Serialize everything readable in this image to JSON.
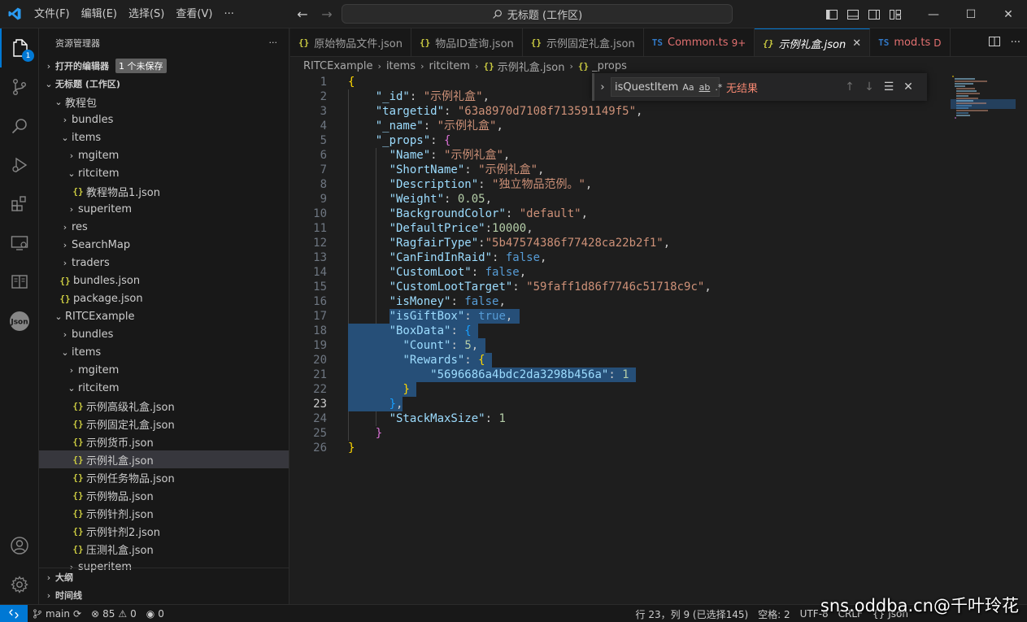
{
  "titlebar": {
    "menu": [
      "文件(F)",
      "编辑(E)",
      "选择(S)",
      "查看(V)",
      "···"
    ],
    "search_text": "无标题 (工作区)"
  },
  "activity": {
    "explorer_badge": "1",
    "json_label": "Json"
  },
  "sidebar": {
    "header": "资源管理器",
    "more": "···",
    "open_editors": "打开的编辑器",
    "unsaved_badge": "1 个未保存",
    "workspace": "无标题 (工作区)",
    "tree": [
      {
        "label": "教程包",
        "indent": 1,
        "type": "folder-open"
      },
      {
        "label": "bundles",
        "indent": 2,
        "type": "folder"
      },
      {
        "label": "items",
        "indent": 2,
        "type": "folder-open"
      },
      {
        "label": "mgitem",
        "indent": 3,
        "type": "folder"
      },
      {
        "label": "ritcitem",
        "indent": 3,
        "type": "folder-open"
      },
      {
        "label": "教程物品1.json",
        "indent": 4,
        "type": "json"
      },
      {
        "label": "superitem",
        "indent": 3,
        "type": "folder"
      },
      {
        "label": "res",
        "indent": 2,
        "type": "folder"
      },
      {
        "label": "SearchMap",
        "indent": 2,
        "type": "folder"
      },
      {
        "label": "traders",
        "indent": 2,
        "type": "folder"
      },
      {
        "label": "bundles.json",
        "indent": 2,
        "type": "json"
      },
      {
        "label": "package.json",
        "indent": 2,
        "type": "json"
      },
      {
        "label": "RITCExample",
        "indent": 1,
        "type": "folder-open"
      },
      {
        "label": "bundles",
        "indent": 2,
        "type": "folder"
      },
      {
        "label": "items",
        "indent": 2,
        "type": "folder-open"
      },
      {
        "label": "mgitem",
        "indent": 3,
        "type": "folder"
      },
      {
        "label": "ritcitem",
        "indent": 3,
        "type": "folder-open"
      },
      {
        "label": "示例高级礼盒.json",
        "indent": 4,
        "type": "json"
      },
      {
        "label": "示例固定礼盒.json",
        "indent": 4,
        "type": "json"
      },
      {
        "label": "示例货币.json",
        "indent": 4,
        "type": "json"
      },
      {
        "label": "示例礼盒.json",
        "indent": 4,
        "type": "json",
        "selected": true
      },
      {
        "label": "示例任务物品.json",
        "indent": 4,
        "type": "json"
      },
      {
        "label": "示例物品.json",
        "indent": 4,
        "type": "json"
      },
      {
        "label": "示例针剂.json",
        "indent": 4,
        "type": "json"
      },
      {
        "label": "示例针剂2.json",
        "indent": 4,
        "type": "json"
      },
      {
        "label": "压测礼盒.json",
        "indent": 4,
        "type": "json"
      },
      {
        "label": "superitem",
        "indent": 3,
        "type": "folder"
      }
    ],
    "outline": "大纲",
    "timeline": "时间线"
  },
  "tabs": [
    {
      "label": "原始物品文件.json",
      "kind": "json"
    },
    {
      "label": "物品ID查询.json",
      "kind": "json"
    },
    {
      "label": "示例固定礼盒.json",
      "kind": "json"
    },
    {
      "label": "Common.ts",
      "kind": "ts",
      "badge": "9+",
      "warn": true
    },
    {
      "label": "示例礼盒.json",
      "kind": "json",
      "active": true
    },
    {
      "label": "mod.ts",
      "kind": "ts",
      "badge": "D",
      "warn": true
    }
  ],
  "breadcrumb": [
    "RITCExample",
    "items",
    "ritcitem",
    "示例礼盒.json",
    "_props"
  ],
  "find": {
    "value": "isQuestItem",
    "opt_case": "Aa",
    "opt_word": "ab",
    "opt_regex": ".*",
    "result": "无结果"
  },
  "code_lines": [
    [
      [
        "{",
        "br1"
      ]
    ],
    [
      [
        "    ",
        ""
      ],
      [
        "\"_id\"",
        "k"
      ],
      [
        ": ",
        "p"
      ],
      [
        "\"示例礼盒\"",
        "s"
      ],
      [
        ",",
        "p"
      ]
    ],
    [
      [
        "    ",
        ""
      ],
      [
        "\"targetid\"",
        "k"
      ],
      [
        ": ",
        "p"
      ],
      [
        "\"63a8970d7108f713591149f5\"",
        "s"
      ],
      [
        ",",
        "p"
      ]
    ],
    [
      [
        "    ",
        ""
      ],
      [
        "\"_name\"",
        "k"
      ],
      [
        ": ",
        "p"
      ],
      [
        "\"示例礼盒\"",
        "s"
      ],
      [
        ",",
        "p"
      ]
    ],
    [
      [
        "    ",
        ""
      ],
      [
        "\"_props\"",
        "k"
      ],
      [
        ": ",
        "p"
      ],
      [
        "{",
        "br2"
      ]
    ],
    [
      [
        "      ",
        ""
      ],
      [
        "\"Name\"",
        "k"
      ],
      [
        ": ",
        "p"
      ],
      [
        "\"示例礼盒\"",
        "s"
      ],
      [
        ",",
        "p"
      ]
    ],
    [
      [
        "      ",
        ""
      ],
      [
        "\"ShortName\"",
        "k"
      ],
      [
        ": ",
        "p"
      ],
      [
        "\"示例礼盒\"",
        "s"
      ],
      [
        ",",
        "p"
      ]
    ],
    [
      [
        "      ",
        ""
      ],
      [
        "\"Description\"",
        "k"
      ],
      [
        ": ",
        "p"
      ],
      [
        "\"独立物品范例。\"",
        "s"
      ],
      [
        ",",
        "p"
      ]
    ],
    [
      [
        "      ",
        ""
      ],
      [
        "\"Weight\"",
        "k"
      ],
      [
        ": ",
        "p"
      ],
      [
        "0.05",
        "n"
      ],
      [
        ",",
        "p"
      ]
    ],
    [
      [
        "      ",
        ""
      ],
      [
        "\"BackgroundColor\"",
        "k"
      ],
      [
        ": ",
        "p"
      ],
      [
        "\"default\"",
        "s"
      ],
      [
        ",",
        "p"
      ]
    ],
    [
      [
        "      ",
        ""
      ],
      [
        "\"DefaultPrice\"",
        "k"
      ],
      [
        ":",
        "p"
      ],
      [
        "10000",
        "n"
      ],
      [
        ",",
        "p"
      ]
    ],
    [
      [
        "      ",
        ""
      ],
      [
        "\"RagfairType\"",
        "k"
      ],
      [
        ":",
        "p"
      ],
      [
        "\"5b47574386f77428ca22b2f1\"",
        "s"
      ],
      [
        ",",
        "p"
      ]
    ],
    [
      [
        "      ",
        ""
      ],
      [
        "\"CanFindInRaid\"",
        "k"
      ],
      [
        ": ",
        "p"
      ],
      [
        "false",
        "b"
      ],
      [
        ",",
        "p"
      ]
    ],
    [
      [
        "      ",
        ""
      ],
      [
        "\"CustomLoot\"",
        "k"
      ],
      [
        ": ",
        "p"
      ],
      [
        "false",
        "b"
      ],
      [
        ",",
        "p"
      ]
    ],
    [
      [
        "      ",
        ""
      ],
      [
        "\"CustomLootTarget\"",
        "k"
      ],
      [
        ": ",
        "p"
      ],
      [
        "\"59faff1d86f7746c51718c9c\"",
        "s"
      ],
      [
        ",",
        "p"
      ]
    ],
    [
      [
        "      ",
        ""
      ],
      [
        "\"isMoney\"",
        "k"
      ],
      [
        ": ",
        "p"
      ],
      [
        "false",
        "b"
      ],
      [
        ",",
        "p"
      ]
    ],
    [
      [
        "      ",
        ""
      ],
      [
        "\"isGiftBox\"",
        "k"
      ],
      [
        ": ",
        "p"
      ],
      [
        "true",
        "b"
      ],
      [
        ",",
        "p"
      ]
    ],
    [
      [
        "      ",
        ""
      ],
      [
        "\"BoxData\"",
        "k"
      ],
      [
        ": ",
        "p"
      ],
      [
        "{",
        "br3"
      ]
    ],
    [
      [
        "        ",
        ""
      ],
      [
        "\"Count\"",
        "k"
      ],
      [
        ": ",
        "p"
      ],
      [
        "5",
        "n"
      ],
      [
        ",",
        "p"
      ]
    ],
    [
      [
        "        ",
        ""
      ],
      [
        "\"Rewards\"",
        "k"
      ],
      [
        ": ",
        "p"
      ],
      [
        "{",
        "br1"
      ]
    ],
    [
      [
        "            ",
        ""
      ],
      [
        "\"5696686a4bdc2da3298b456a\"",
        "k"
      ],
      [
        ": ",
        "p"
      ],
      [
        "1",
        "n"
      ]
    ],
    [
      [
        "        ",
        ""
      ],
      [
        "}",
        "br1"
      ]
    ],
    [
      [
        "      ",
        ""
      ],
      [
        "}",
        "br3"
      ],
      [
        ",",
        "p"
      ]
    ],
    [
      [
        "      ",
        ""
      ],
      [
        "\"StackMaxSize\"",
        "k"
      ],
      [
        ": ",
        "p"
      ],
      [
        "1",
        "n"
      ]
    ],
    [
      [
        "    ",
        ""
      ],
      [
        "}",
        "br2"
      ]
    ],
    [
      [
        "}",
        "br1"
      ]
    ]
  ],
  "status": {
    "branch": "main",
    "errors": "85",
    "warnings": "0",
    "ports": "0",
    "position": "行 23，列 9 (已选择145)",
    "spaces": "空格: 2",
    "encoding": "UTF-8",
    "eol": "CRLF",
    "lang": "Json"
  },
  "watermark": "sns.oddba.cn@千叶玲花"
}
